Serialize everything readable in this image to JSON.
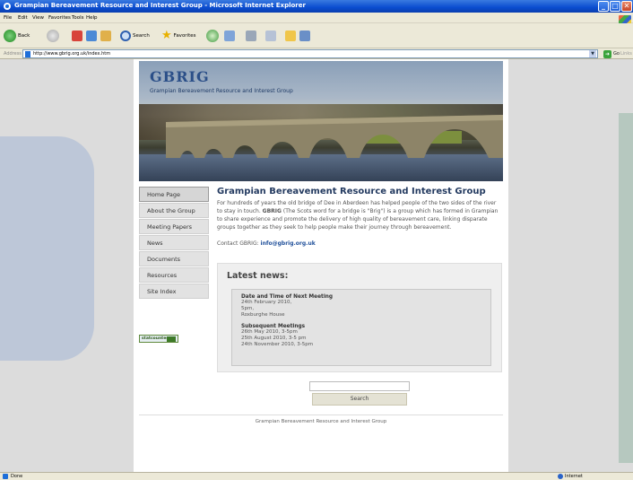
{
  "window": {
    "title": "Grampian Bereavement Resource and Interest Group - Microsoft Internet Explorer",
    "controls": [
      "_",
      "□",
      "✕"
    ]
  },
  "menubar": {
    "items": [
      "File",
      "Edit",
      "View",
      "Favorites",
      "Tools",
      "Help"
    ]
  },
  "toolbar": {
    "back_label": "Back",
    "search_label": "Search",
    "favorites_label": "Favorites"
  },
  "addressbar": {
    "label": "Address",
    "url": "http://www.gbrig.org.uk/index.htm",
    "go_label": "Go",
    "links_label": "Links"
  },
  "header": {
    "logo": "GBRIG",
    "tagline": "Grampian Bereavement Resource and Interest Group"
  },
  "nav": {
    "items": [
      {
        "label": "Home Page",
        "active": true
      },
      {
        "label": "About the Group"
      },
      {
        "label": "Meeting Papers"
      },
      {
        "label": "News"
      },
      {
        "label": "Documents"
      },
      {
        "label": "Resources"
      },
      {
        "label": "Site Index"
      }
    ],
    "badge": "statcounter"
  },
  "content": {
    "heading": "Grampian Bereavement Resource and Interest Group",
    "intro_1": "For hundreds of years the old bridge of Dee in Aberdeen has helped people of the two sides of the river to stay in touch. ",
    "intro_bold": "GBRIG",
    "intro_2": " (The Scots word for a bridge is \"Brig\") is a group which has formed in Grampian to share experience and promote the delivery of high quality of bereavement care, linking disparate groups together as they seek to help people make their journey through bereavement.",
    "contact_label": "Contact GBRIG: ",
    "contact_email": "info@gbrig.org.uk"
  },
  "news": {
    "heading": "Latest news:",
    "block1_title": "Date and Time of Next Meeting",
    "block1_lines": [
      "24th February 2010,",
      "5pm,",
      "Roxburghe House"
    ],
    "block2_title": "Subsequent Meetings",
    "block2_lines": [
      "26th May 2010, 3-5pm",
      "25th August 2010, 3-5 pm",
      "24th November 2010, 3-5pm"
    ]
  },
  "search": {
    "placeholder": "",
    "button_label": "Search"
  },
  "footer": {
    "text": "Grampian Bereavement Resource and Interest Group"
  },
  "statusbar": {
    "status": "Done",
    "zone": "Internet"
  }
}
